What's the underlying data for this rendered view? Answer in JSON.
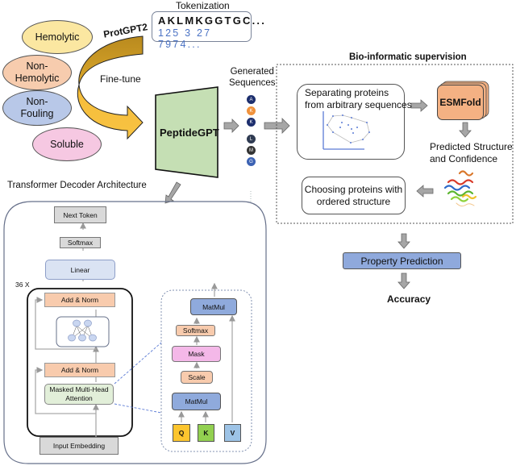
{
  "properties": [
    {
      "label": "Hemolytic",
      "color": "#fbe7a1"
    },
    {
      "label": "Non-\nHemolytic",
      "color": "#f7ccae"
    },
    {
      "label": "Non-\nFouling",
      "color": "#b8c8e8"
    },
    {
      "label": "Soluble",
      "color": "#f6c8e2"
    }
  ],
  "base_model": "ProtGPT2",
  "finetune_label": "Fine-tune",
  "model_name": "PeptideGPT",
  "tokenization": {
    "title": "Tokenization",
    "letters": "AKLMKGGTGC...",
    "numbers": "125 3 27 7974..."
  },
  "generated": {
    "title_line1": "Generated",
    "title_line2": "Sequences",
    "beads": [
      {
        "letter": "A",
        "color": "#1d2f6e"
      },
      {
        "letter": "K",
        "color": "#f0923c"
      },
      {
        "letter": "K",
        "color": "#1d2f6e"
      },
      {
        "letter": "L",
        "color": "#2f3b52"
      },
      {
        "letter": "M",
        "color": "#333333"
      },
      {
        "letter": "G",
        "color": "#3c62b3"
      }
    ]
  },
  "supervision": {
    "title": "Bio-informatic supervision",
    "separating_line1": "Separating proteins",
    "separating_line2": "from arbitrary sequences",
    "esmfold": "ESMFold",
    "predicted_line1": "Predicted Structure",
    "predicted_line2": "and Confidence",
    "choosing_line1": "Choosing proteins with",
    "choosing_line2": "ordered structure"
  },
  "property_prediction": "Property Prediction",
  "accuracy": "Accuracy",
  "decoder": {
    "title": "Transformer Decoder Architecture",
    "next_token": "Next Token",
    "softmax": "Softmax",
    "linear": "Linear",
    "repeat": "36  X",
    "add_norm_top": "Add & Norm",
    "add_norm_bottom": "Add & Norm",
    "attention_line1": "Masked Multi-Head",
    "attention_line2": "Attention",
    "input_embedding": "Input Embedding"
  },
  "attention_detail": {
    "matmul_top": "MatMul",
    "softmax": "Softmax",
    "mask": "Mask",
    "scale": "Scale",
    "matmul_bottom": "MatMul",
    "q": "Q",
    "k": "K",
    "v": "V"
  },
  "colors": {
    "peptidegpt": "#c5dfb4",
    "esmfold": "#f4b183",
    "property_prediction": "#8fa9dc",
    "add_norm": "#f8cbad",
    "attention": "#e2efd9",
    "linear": "#dae3f3",
    "matmul": "#8faadc",
    "mask": "#f4b8e8",
    "q": "#fcc52e",
    "k": "#92d050",
    "v": "#9dc3e6"
  }
}
